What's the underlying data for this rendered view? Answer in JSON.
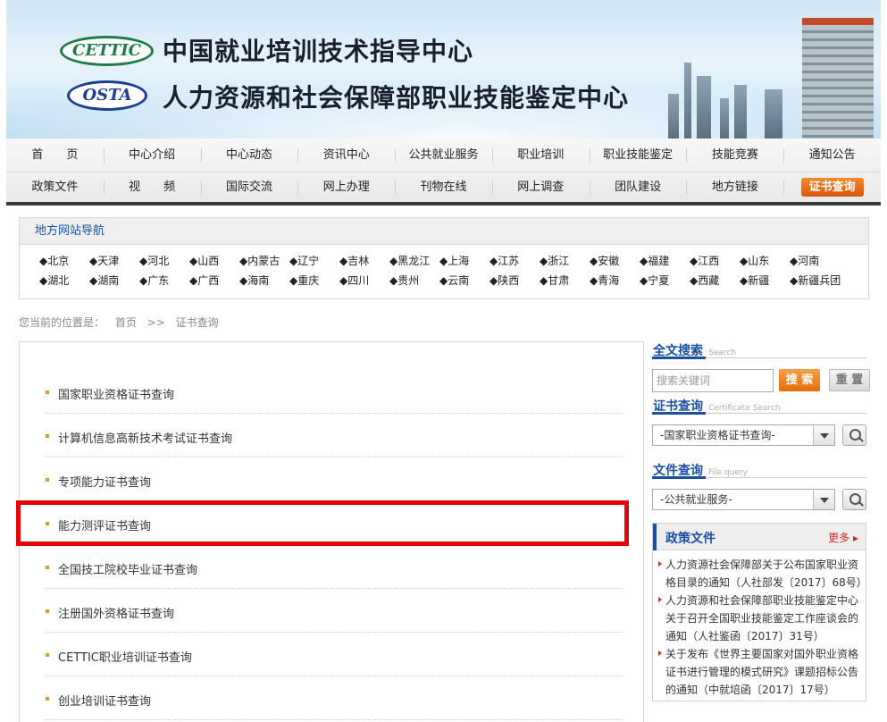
{
  "banner": {
    "logo1": "CETTIC",
    "logo2": "OSTA",
    "title1": "中国就业培训技术指导中心",
    "title2": "人力资源和社会保障部职业技能鉴定中心"
  },
  "nav": {
    "row1": [
      "首　　页",
      "中心介绍",
      "中心动态",
      "资讯中心",
      "公共就业服务",
      "职业培训",
      "职业技能鉴定",
      "技能竞赛",
      "通知公告"
    ],
    "row2": [
      "政策文件",
      "视　　频",
      "国际交流",
      "网上办理",
      "刊物在线",
      "网上调查",
      "团队建设",
      "地方链接",
      "证书查询"
    ]
  },
  "region": {
    "title": "地方网站导航",
    "items": [
      "◆北京",
      "◆天津",
      "◆河北",
      "◆山西",
      "◆内蒙古",
      "◆辽宁",
      "◆吉林",
      "◆黑龙江",
      "◆上海",
      "◆江苏",
      "◆浙江",
      "◆安徽",
      "◆福建",
      "◆江西",
      "◆山东",
      "◆河南",
      "◆湖北",
      "◆湖南",
      "◆广东",
      "◆广西",
      "◆海南",
      "◆重庆",
      "◆四川",
      "◆贵州",
      "◆云南",
      "◆陕西",
      "◆甘肃",
      "◆青海",
      "◆宁夏",
      "◆西藏",
      "◆新疆",
      "◆新疆兵团"
    ]
  },
  "breadcrumb": {
    "prefix": "您当前的位置是：",
    "home": "首页",
    "sep": ">>",
    "current": "证书查询"
  },
  "list": [
    "国家职业资格证书查询",
    "计算机信息高新技术考试证书查询",
    "专项能力证书查询",
    "能力测评证书查询",
    "全国技工院校毕业证书查询",
    "注册国外资格证书查询",
    "CETTIC职业培训证书查询",
    "创业培训证书查询"
  ],
  "side": {
    "search_title": "全文搜索",
    "search_sub": "Search",
    "search_placeholder": "搜索关键词",
    "search_btn": "搜 索",
    "reset_btn": "重 置",
    "cert_title": "证书查询",
    "cert_sub": "Certificate Search",
    "cert_select": "-国家职业资格证书查询-",
    "file_title": "文件查询",
    "file_sub": "File query",
    "file_select": "-公共就业服务-",
    "policy_title": "政策文件",
    "policy_more": "更多",
    "policy_items": [
      "人力资源社会保障部关于公布国家职业资格目录的通知（人社部发〔2017〕68号）",
      "人力资源和社会保障部职业技能鉴定中心关于召开全国职业技能鉴定工作座谈会的通知（人社鉴函〔2017〕31号）",
      "关于发布《世界主要国家对国外职业资格证书进行管理的模式研究》课题招标公告的通知（中就培函〔2017〕17号）"
    ]
  }
}
